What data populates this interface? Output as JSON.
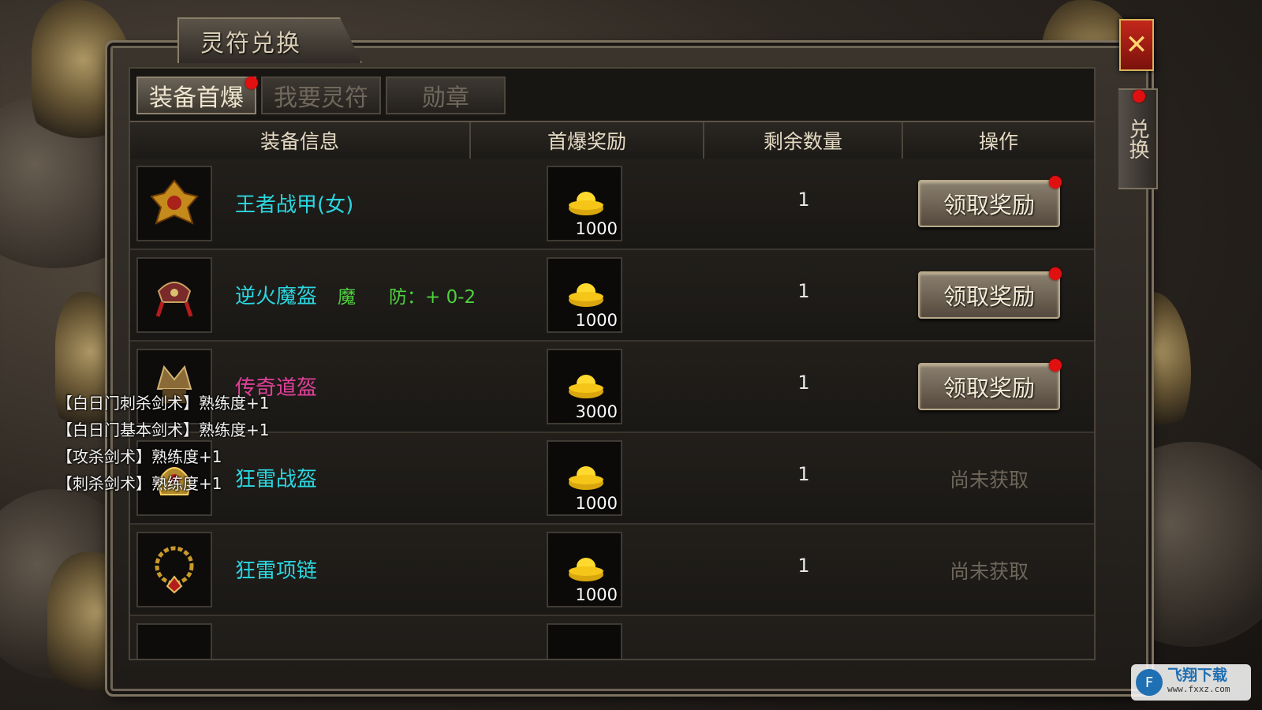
{
  "window": {
    "title": "灵符兑换",
    "close_icon": "close-icon",
    "side_tab_label": "兑换"
  },
  "tabs": [
    {
      "label": "装备首爆",
      "active": true,
      "badge": true
    },
    {
      "label": "我要灵符",
      "active": false,
      "badge": false
    },
    {
      "label": "勋章",
      "active": false,
      "badge": false
    }
  ],
  "table": {
    "headers": [
      "装备信息",
      "首爆奖励",
      "剩余数量",
      "操作"
    ],
    "rows": [
      {
        "name": "王者战甲(女)",
        "name_color": "#2bd6e0",
        "attr1": "",
        "attr2": "",
        "reward": "1000",
        "qty": "1",
        "action": "领取奖励",
        "claimable": true
      },
      {
        "name": "逆火魔盔",
        "name_color": "#2bd6e0",
        "attr1": "魔",
        "attr2": "防：+ 0-2",
        "reward": "1000",
        "qty": "1",
        "action": "领取奖励",
        "claimable": true
      },
      {
        "name": "传奇道盔",
        "name_color": "#e0409a",
        "attr1": "",
        "attr2": "",
        "reward": "3000",
        "qty": "1",
        "action": "领取奖励",
        "claimable": true
      },
      {
        "name": "狂雷战盔",
        "name_color": "#2bd6e0",
        "attr1": "",
        "attr2": "",
        "reward": "1000",
        "qty": "1",
        "action": "尚未获取",
        "claimable": false
      },
      {
        "name": "狂雷项链",
        "name_color": "#2bd6e0",
        "attr1": "",
        "attr2": "",
        "reward": "1000",
        "qty": "1",
        "action": "尚未获取",
        "claimable": false
      }
    ]
  },
  "log": [
    "【白日门刺杀剑术】熟练度+1",
    "【白日门基本剑术】熟练度+1",
    "【攻杀剑术】熟练度+1",
    "【刺杀剑术】熟练度+1"
  ],
  "watermark": {
    "main": "飞翔下载",
    "url": "www.fxxz.com"
  },
  "colors": {
    "accent_red": "#e01010",
    "cyan_name": "#2bd6e0",
    "pink_name": "#e0409a",
    "green_attr": "#4fd13f"
  }
}
